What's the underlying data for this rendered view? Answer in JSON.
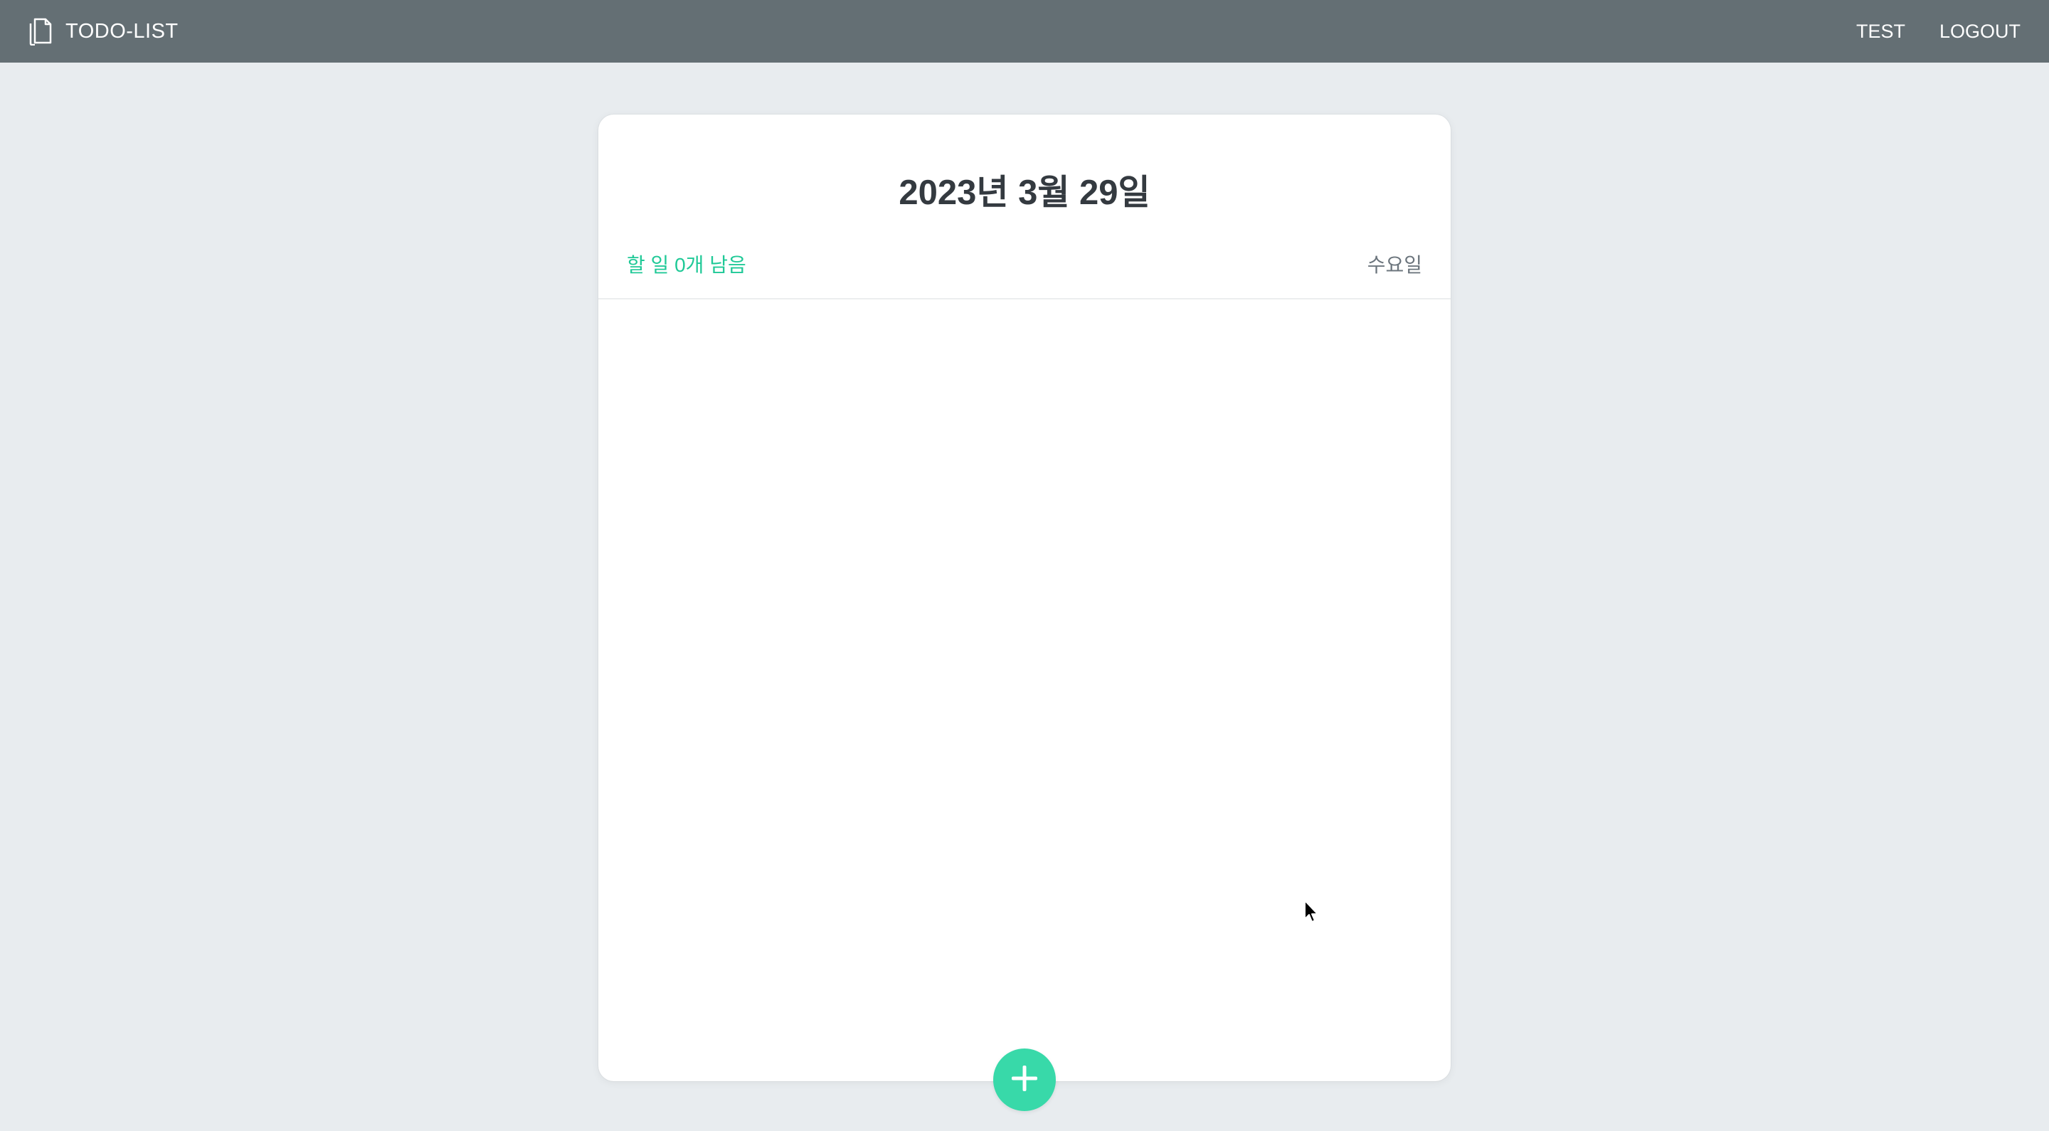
{
  "navbar": {
    "brand_icon": "document-icon",
    "brand_title": "TODO-LIST",
    "links": [
      "TEST",
      "LOGOUT"
    ]
  },
  "card": {
    "date": "2023년 3월 29일",
    "tasks_left": "할 일 0개 남음",
    "weekday": "수요일",
    "items": []
  },
  "add_button": {
    "icon": "plus-icon"
  },
  "colors": {
    "navbar_bg": "#646f74",
    "page_bg": "#e8ecef",
    "accent": "#20c997",
    "add_button_bg": "#38d9a9",
    "title_text": "#343a40",
    "secondary_text": "#6c757d"
  }
}
